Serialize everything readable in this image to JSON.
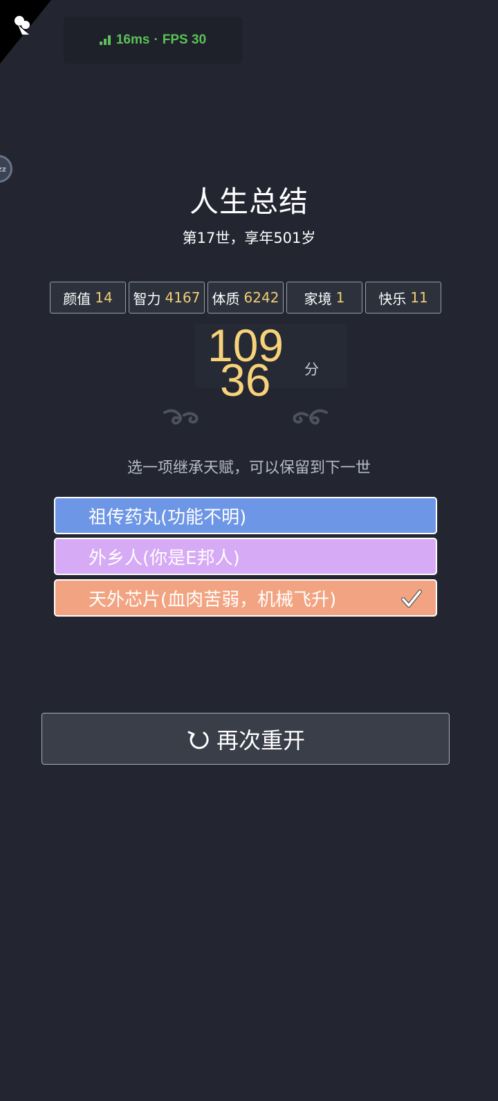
{
  "overlay": {
    "latency": "16ms",
    "separator": "·",
    "fps": "FPS 30",
    "float_ball_text": "zz"
  },
  "summary": {
    "title": "人生总结",
    "subtitle": "第17世，享年501岁"
  },
  "stats": [
    {
      "label": "颜值",
      "value": "14"
    },
    {
      "label": "智力",
      "value": "4167"
    },
    {
      "label": "体质",
      "value": "6242"
    },
    {
      "label": "家境",
      "value": "1"
    },
    {
      "label": "快乐",
      "value": "11"
    }
  ],
  "score": {
    "line1": "109",
    "line2": "36",
    "unit": "分"
  },
  "talents": {
    "hint": "选一项继承天赋，可以保留到下一世",
    "items": [
      {
        "label": "祖传药丸(功能不明)",
        "selected": false,
        "color": "#6e96e6"
      },
      {
        "label": "外乡人(你是E邦人)",
        "selected": false,
        "color": "#d6aaf5"
      },
      {
        "label": "天外芯片(血肉苦弱，机械飞升)",
        "selected": true,
        "color": "#f2a482"
      }
    ]
  },
  "actions": {
    "restart_label": "再次重开",
    "restart_icon": "refresh-icon"
  },
  "colors": {
    "background": "#232631",
    "accent_gold": "#f2cf74",
    "fps_green": "#5cc15a"
  }
}
